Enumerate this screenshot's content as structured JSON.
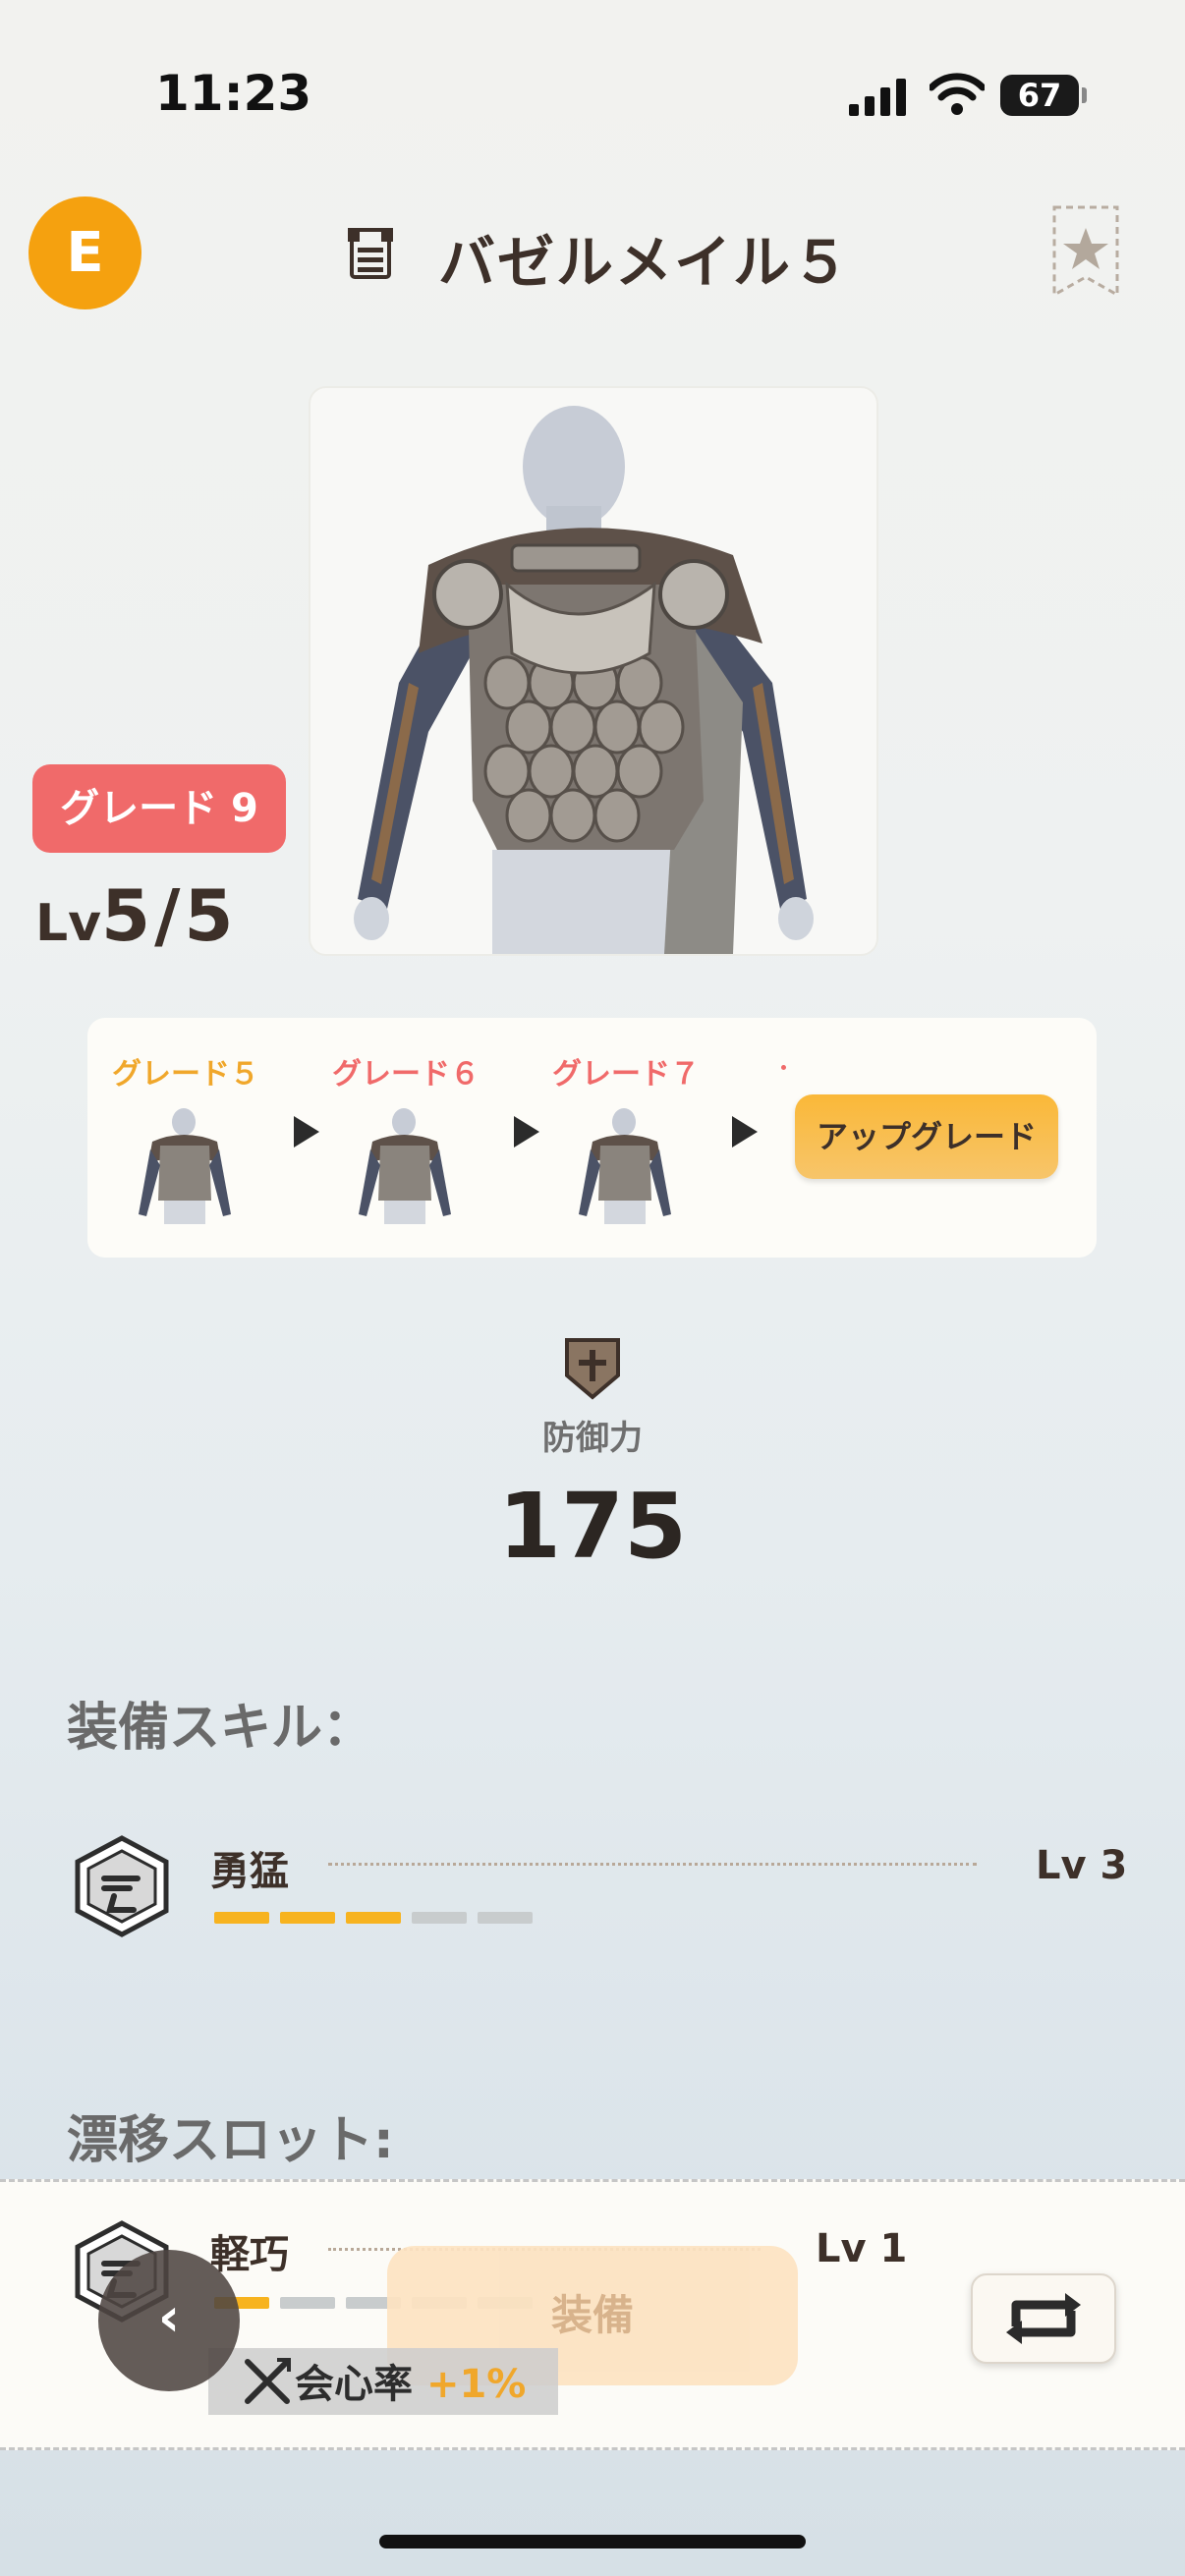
{
  "status_bar": {
    "time": "11:23",
    "battery": "67"
  },
  "header": {
    "badge_letter": "E",
    "title": "バゼルメイル５"
  },
  "item": {
    "grade_badge": "グレード 9",
    "level_prefix": "Lv",
    "level_value": "5/5"
  },
  "upgrade_path": {
    "steps": [
      {
        "label": "グレード５",
        "color": "#f0a72b"
      },
      {
        "label": "グレード６",
        "color": "#f06a6a"
      },
      {
        "label": "グレード７",
        "color": "#f06a6a"
      }
    ],
    "button_label": "アップグレード"
  },
  "defense": {
    "label": "防御力",
    "value": "175"
  },
  "equipment_skills": {
    "title": "装備スキル：",
    "skills": [
      {
        "name": "勇猛",
        "level": "Lv 3",
        "filled": 3,
        "total": 5
      }
    ]
  },
  "drift_slots": {
    "title": "漂移スロット:",
    "slots": [
      {
        "name": "軽巧",
        "level": "Lv 1",
        "filled": 1,
        "total": 5
      }
    ]
  },
  "bottom": {
    "equip_label": "装備",
    "crit_label": "会心率",
    "crit_value": "+1%"
  },
  "colors": {
    "accent_orange": "#f5a10f",
    "grade_red": "#f06a6a",
    "skill_bar": "#f7b31f"
  }
}
